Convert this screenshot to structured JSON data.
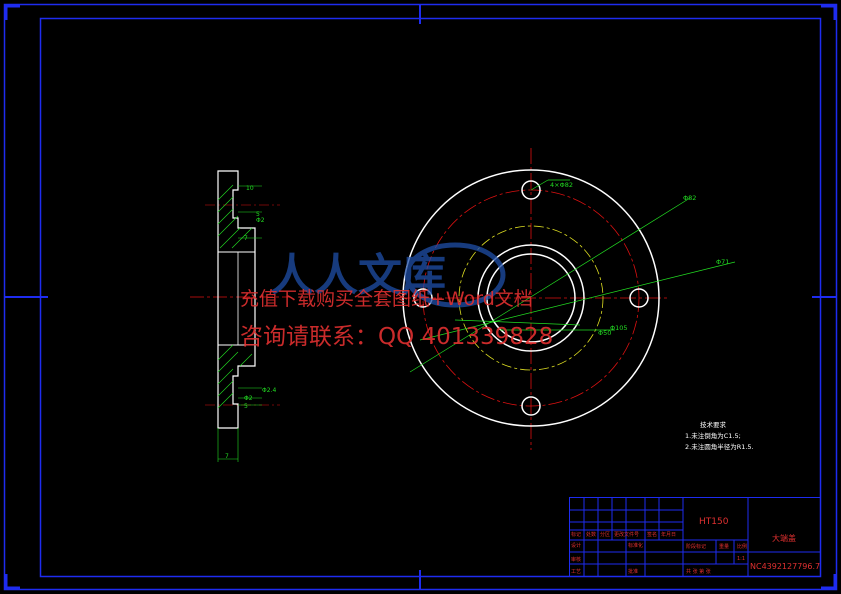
{
  "colors": {
    "background": "#000000",
    "frame": "#1e2cf0",
    "outline": "#ffffff",
    "dimension": "#22dd22",
    "center_line": "#dd1111",
    "pitch_line": "#dddd22",
    "watermark_text": "#e03030",
    "watermark_logo": "#1f4fa8",
    "title_text": "#e03030"
  },
  "side_view": {
    "dims": [
      "10",
      "5",
      "Φ2",
      "7",
      "5",
      "Φ2.4",
      "Φ2",
      "5"
    ],
    "width_label": "7"
  },
  "front_view": {
    "dims": [
      "4×Φ82",
      "Φ82",
      "Φ71",
      "Φ50",
      "Φ105"
    ]
  },
  "notes": {
    "title": "技术要求",
    "items": [
      "1.未注倒角为C1.5;",
      "2.未注圆角半径为R1.5."
    ]
  },
  "watermark": {
    "line1": "充值下载购买全套图纸+Word文档",
    "line2": "咨询请联系：QQ 401339828"
  },
  "title_block": {
    "material": "HT150",
    "part_name": "大端盖",
    "drawing_no": "NC4392127796.7",
    "row_labels": [
      "标记",
      "处数",
      "分区",
      "更改文件号",
      "签名",
      "年月日"
    ],
    "left_labels": [
      "设计",
      "审核",
      "工艺"
    ],
    "mid_labels": [
      "标准化",
      "批准"
    ],
    "stage_labels": [
      "阶段标记",
      "重量",
      "比例"
    ],
    "sheet_label": "共 张 第 张",
    "scale_value": "1:1"
  }
}
